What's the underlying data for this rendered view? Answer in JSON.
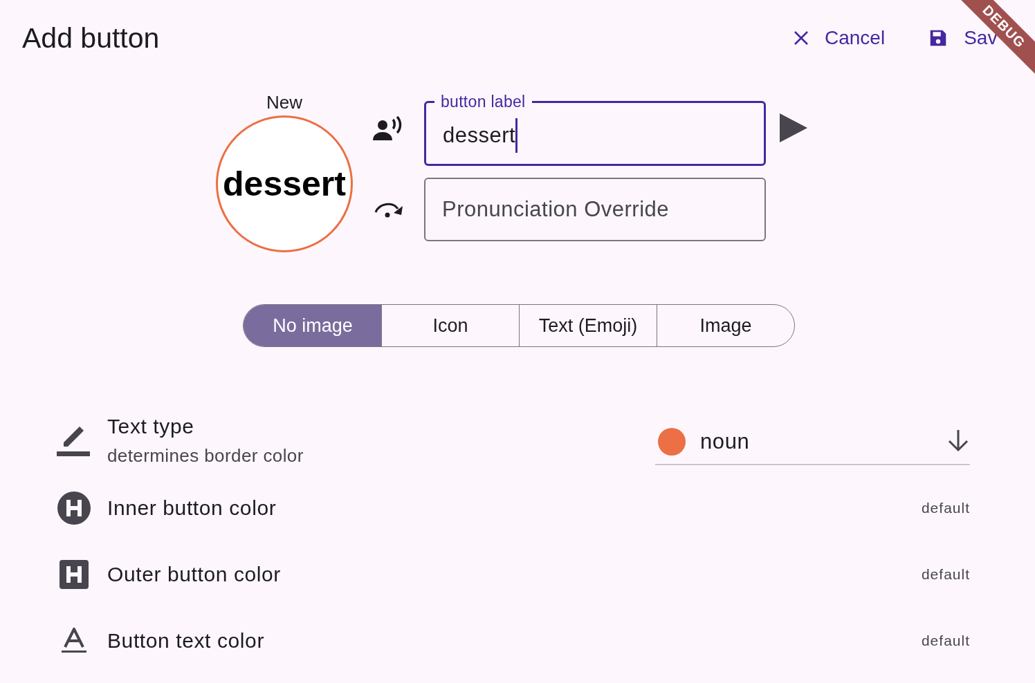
{
  "app_bar": {
    "title": "Add button",
    "actions": [
      {
        "kind": "cancel",
        "label": "Cancel"
      },
      {
        "kind": "save",
        "label": "Sav"
      }
    ]
  },
  "debug_banner": "DEBUG",
  "preview": {
    "caption": "New",
    "label": "dessert"
  },
  "fields": [
    {
      "kind": "speak",
      "floating_label": "button label",
      "value": "dessert",
      "focused": true
    },
    {
      "kind": "pronounce",
      "placeholder": "Pronunciation Override",
      "focused": false
    }
  ],
  "image_modes": [
    {
      "label": "No image",
      "selected": true
    },
    {
      "label": "Icon",
      "selected": false
    },
    {
      "label": "Text (Emoji)",
      "selected": false
    },
    {
      "label": "Image",
      "selected": false
    }
  ],
  "settings": [
    {
      "kind": "text_type",
      "title": "Text type",
      "subtitle": "determines border color",
      "dropdown": {
        "value": "noun",
        "color": "#ec6f45"
      }
    },
    {
      "kind": "inner_color",
      "title": "Inner button color",
      "value": "default"
    },
    {
      "kind": "outer_color",
      "title": "Outer button color",
      "value": "default"
    },
    {
      "kind": "text_color",
      "title": "Button text color",
      "value": "default"
    }
  ]
}
